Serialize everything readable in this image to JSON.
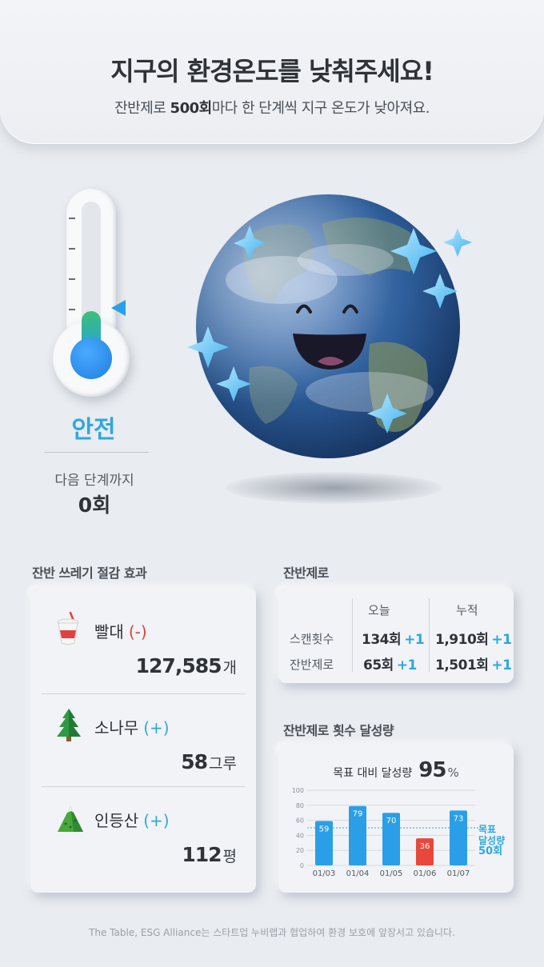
{
  "header": {
    "title": "지구의 환경온도를 낮춰주세요!",
    "subtitle_prefix": "잔반제로 ",
    "subtitle_bold": "500회",
    "subtitle_suffix": "마다 한 단계씩 지구 온도가 낮아져요."
  },
  "thermometer": {
    "level": 0.3,
    "status": "안전",
    "next_label": "다음 단계까지",
    "next_count": "0회"
  },
  "reduction": {
    "title": "잔반 쓰레기 절감 효과",
    "items": [
      {
        "icon": "cup-straw-icon",
        "name": "빨대",
        "sign": "(-)",
        "value": "127,585",
        "unit": "개"
      },
      {
        "icon": "pine-tree-icon",
        "name": "소나무",
        "sign": "(+)",
        "value": "58",
        "unit": "그루"
      },
      {
        "icon": "mountain-icon",
        "name": "인등산",
        "sign": "(+)",
        "value": "112",
        "unit": "평"
      }
    ]
  },
  "stats": {
    "title": "잔반제로",
    "col_today": "오늘",
    "col_total": "누적",
    "rows": [
      {
        "label": "스캔횟수",
        "today": "134회",
        "today_inc": "+1",
        "total": "1,910회",
        "total_inc": "+1"
      },
      {
        "label": "잔반제로",
        "today": "65회",
        "today_inc": "+1",
        "total": "1,501회",
        "total_inc": "+1"
      }
    ]
  },
  "achievement": {
    "title": "잔반제로 횟수 달성량",
    "chart_title": "목표 대비 달성량",
    "percent": "95",
    "percent_sign": "%",
    "goal_label_1": "목표",
    "goal_label_2": "달성량",
    "goal_value": "50회"
  },
  "chart_data": {
    "type": "bar",
    "categories": [
      "01/03",
      "01/04",
      "01/05",
      "01/06",
      "01/07"
    ],
    "values": [
      59,
      79,
      70,
      36,
      73
    ],
    "ylim": [
      0,
      100
    ],
    "yticks": [
      0,
      20,
      40,
      60,
      80,
      100
    ],
    "goal_line": 50,
    "colors": {
      "normal": "#2a9fe8",
      "below_goal": "#e8483c"
    }
  },
  "footer": {
    "text": "The Table, ESG Alliance는 스타트업 누비랩과 협업하여 환경 보호에 앞장서고 있습니다."
  }
}
